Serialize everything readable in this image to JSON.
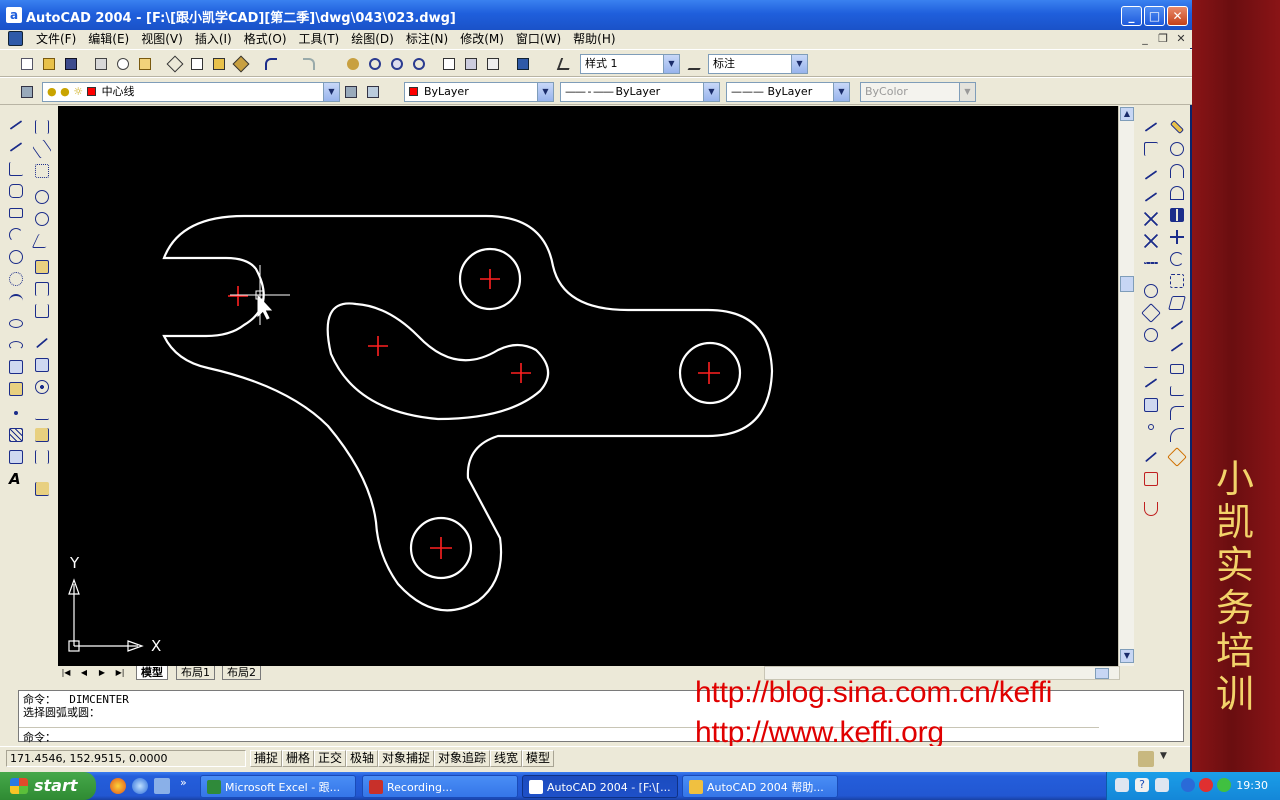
{
  "window": {
    "title": "AutoCAD 2004 - [F:\\[跟小凯学CAD][第二季]\\dwg\\043\\023.dwg]",
    "app_icon_letter": "a",
    "minimize": "_",
    "maximize": "□",
    "close": "✕"
  },
  "menu": {
    "items": [
      "文件(F)",
      "编辑(E)",
      "视图(V)",
      "插入(I)",
      "格式(O)",
      "工具(T)",
      "绘图(D)",
      "标注(N)",
      "修改(M)",
      "窗口(W)",
      "帮助(H)"
    ],
    "doc_min": "_",
    "doc_restore": "❐",
    "doc_close": "✕"
  },
  "toolbar1": {
    "text_style": "样式 1",
    "dim_style": "标注"
  },
  "toolbar2": {
    "layer": "中心线",
    "color": "ByLayer",
    "linetype": "ByLayer",
    "lineweight": "ByLayer",
    "plot_style": "ByColor",
    "colors": {
      "layer_swatch": "#ff0000",
      "color_swatch": "#ff0000"
    }
  },
  "canvas": {
    "background": "#000000",
    "geometry_color": "#ffffff",
    "center_mark_color": "#ff0000",
    "ucs_x_label": "X",
    "ucs_y_label": "Y"
  },
  "tabs": {
    "items": [
      "模型",
      "布局1",
      "布局2"
    ],
    "active": "模型"
  },
  "command": {
    "line1": "命令：  DIMCENTER",
    "line2": "选择圆弧或圆：",
    "prompt": "命令："
  },
  "overlay": {
    "url1": "http://blog.sina.com.cn/keffi",
    "url2": "http://www.keffi.org"
  },
  "status": {
    "coords": "171.4546, 152.9515, 0.0000",
    "buttons": [
      "捕捉",
      "栅格",
      "正交",
      "极轴",
      "对象捕捉",
      "对象追踪",
      "线宽",
      "模型"
    ]
  },
  "banner": {
    "text": "小凯实务培训"
  },
  "taskbar": {
    "start": "start",
    "tasks": [
      {
        "label": "Microsoft Excel - 跟...",
        "active": false
      },
      {
        "label": "Recording...",
        "active": false
      },
      {
        "label": "AutoCAD 2004 - [F:\\[...",
        "active": true
      },
      {
        "label": "AutoCAD 2004 帮助...",
        "active": false
      }
    ],
    "clock": "19:30"
  }
}
